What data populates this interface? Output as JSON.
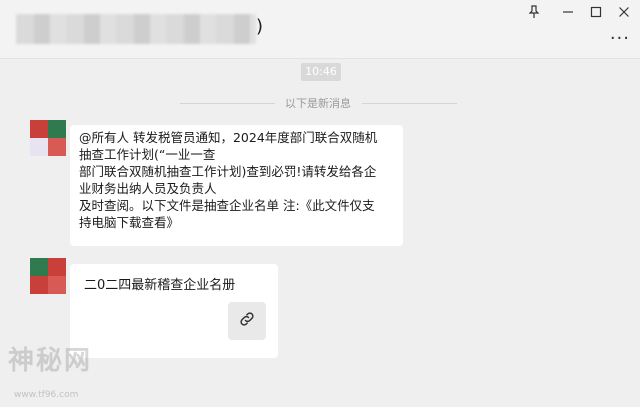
{
  "window": {
    "title_suffix": ")",
    "controls": {
      "pin_glyph": "⟟",
      "minimize_glyph": "—",
      "maximize_glyph": "☐",
      "close_glyph": "✕"
    },
    "more_glyph": "···"
  },
  "chat": {
    "time": "10:46",
    "new_messages_divider": "以下是新消息",
    "messages": [
      {
        "lines": [
          "@所有人 转发税管员通知，2024年度部门联合双随机",
          "抽查工作计划(“一业一查",
          "部门联合双随机抽查工作计划)查到必罚!请转发给各企",
          "业财务出纳人员及负责人",
          "及时查阅。以下文件是抽查企业名单 注:《此文件仅支",
          "持电脑下载查看》"
        ]
      },
      {
        "file_title": "二0二四最新稽查企业名册",
        "link_icon": "link-icon"
      }
    ]
  },
  "watermark": {
    "text": "神秘网",
    "sub": "www.tf96.com"
  },
  "colors": {
    "background": "#efefef",
    "bubble": "#ffffff",
    "divider_text": "#999999"
  }
}
